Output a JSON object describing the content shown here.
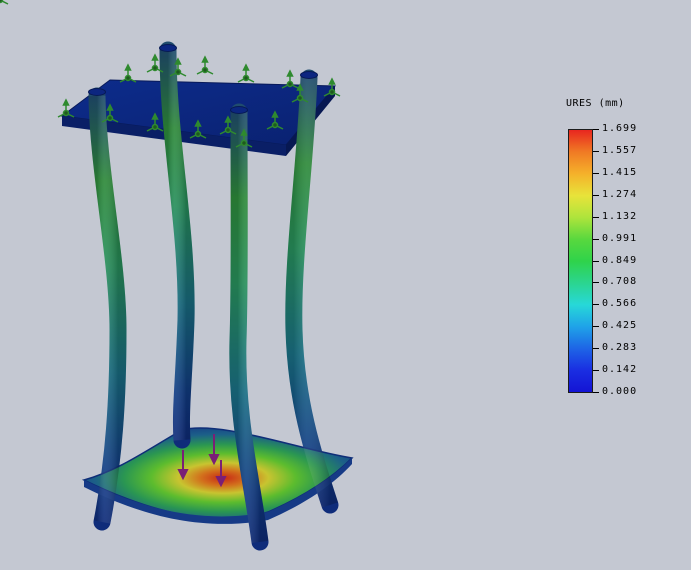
{
  "legend": {
    "title": "URES (mm)",
    "values": [
      "1.699",
      "1.557",
      "1.415",
      "1.274",
      "1.132",
      "0.991",
      "0.849",
      "0.708",
      "0.566",
      "0.425",
      "0.283",
      "0.142",
      "0.000"
    ],
    "gradient_colors": [
      "#e8261f",
      "#f07a24",
      "#f5b12a",
      "#e8e33a",
      "#aee43c",
      "#59d83e",
      "#2fd34a",
      "#2bd58f",
      "#27d8d8",
      "#1fa3e8",
      "#1e65e6",
      "#1a2ee2",
      "#1414d4"
    ]
  },
  "colors": {
    "background": "#c4c8d2",
    "low_displacement": "#0e2a82",
    "mid_displacement": "#2e9e4e",
    "fixture_arrows": "#2f8a2f",
    "load_arrows": "#7a1f76"
  },
  "icons": {
    "fixture": "fixed-geometry-arrow-icon",
    "load": "force-arrow-icon"
  }
}
